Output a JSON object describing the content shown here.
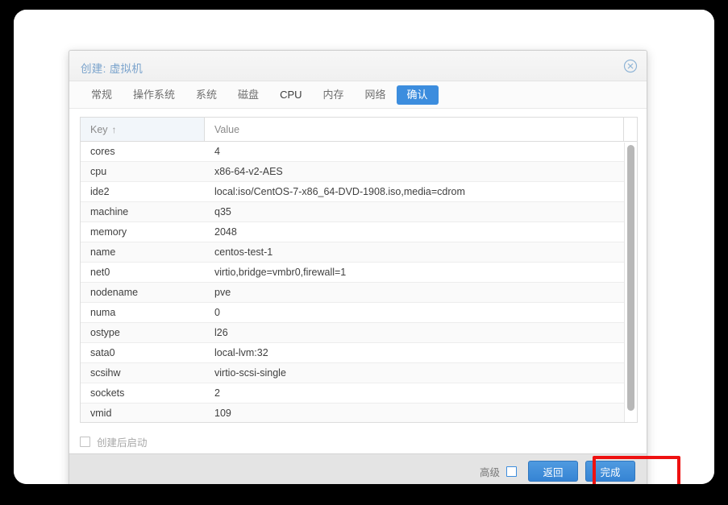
{
  "dialog": {
    "title": "创建: 虚拟机",
    "close_icon": "close-circle-icon"
  },
  "tabs": [
    {
      "label": "常规",
      "active": false,
      "latin": false
    },
    {
      "label": "操作系统",
      "active": false,
      "latin": false
    },
    {
      "label": "系统",
      "active": false,
      "latin": false
    },
    {
      "label": "磁盘",
      "active": false,
      "latin": false
    },
    {
      "label": "CPU",
      "active": false,
      "latin": true
    },
    {
      "label": "内存",
      "active": false,
      "latin": false
    },
    {
      "label": "网络",
      "active": false,
      "latin": false
    },
    {
      "label": "确认",
      "active": true,
      "latin": false
    }
  ],
  "grid": {
    "columns": [
      "Key",
      "Value"
    ],
    "sort_arrow": "↑",
    "rows": [
      {
        "key": "cores",
        "value": "4"
      },
      {
        "key": "cpu",
        "value": "x86-64-v2-AES"
      },
      {
        "key": "ide2",
        "value": "local:iso/CentOS-7-x86_64-DVD-1908.iso,media=cdrom"
      },
      {
        "key": "machine",
        "value": "q35"
      },
      {
        "key": "memory",
        "value": "2048"
      },
      {
        "key": "name",
        "value": "centos-test-1"
      },
      {
        "key": "net0",
        "value": "virtio,bridge=vmbr0,firewall=1"
      },
      {
        "key": "nodename",
        "value": "pve"
      },
      {
        "key": "numa",
        "value": "0"
      },
      {
        "key": "ostype",
        "value": "l26"
      },
      {
        "key": "sata0",
        "value": "local-lvm:32"
      },
      {
        "key": "scsihw",
        "value": "virtio-scsi-single"
      },
      {
        "key": "sockets",
        "value": "2"
      },
      {
        "key": "vmid",
        "value": "109"
      }
    ]
  },
  "options": {
    "start_after_create_label": "创建后启动",
    "start_after_create_checked": false
  },
  "footer": {
    "advanced_label": "高级",
    "advanced_checked": false,
    "back_label": "返回",
    "finish_label": "完成"
  },
  "colors": {
    "accent_blue": "#3c8dde",
    "title_blue": "#7aa3cc",
    "annotation_red": "#ee1111",
    "footer_bg": "#e4e4e4"
  }
}
